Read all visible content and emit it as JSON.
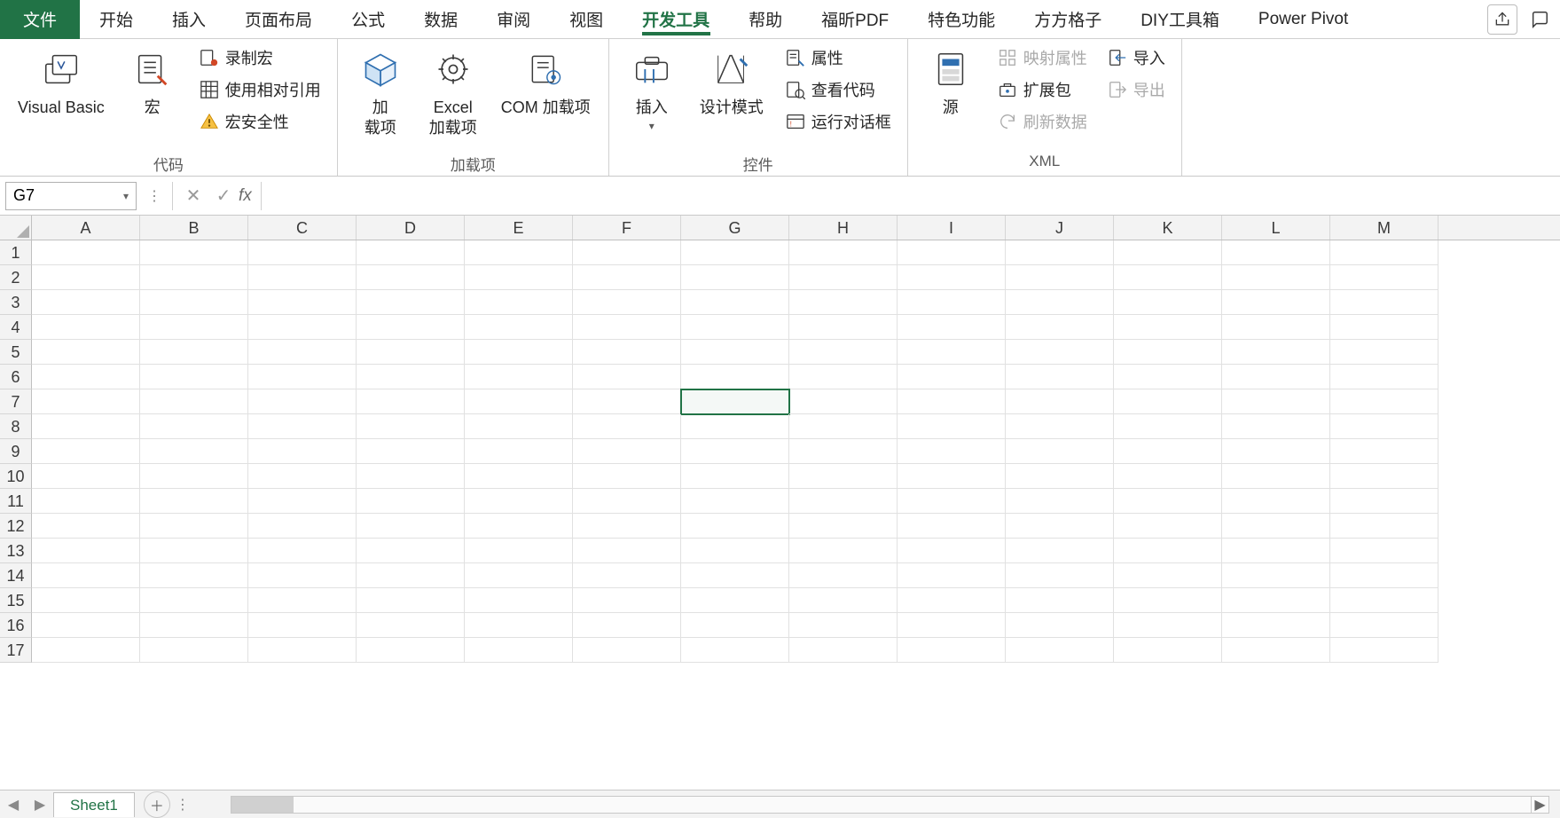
{
  "tabs": {
    "file": "文件",
    "items": [
      "开始",
      "插入",
      "页面布局",
      "公式",
      "数据",
      "审阅",
      "视图",
      "开发工具",
      "帮助",
      "福昕PDF",
      "特色功能",
      "方方格子",
      "DIY工具箱",
      "Power Pivot"
    ],
    "activeIndex": 7
  },
  "ribbon": {
    "groups": {
      "code": {
        "label": "代码",
        "visualBasic": "Visual Basic",
        "macros": "宏",
        "recordMacro": "录制宏",
        "useRelativeRefs": "使用相对引用",
        "macroSecurity": "宏安全性"
      },
      "addins": {
        "label": "加载项",
        "addins": "加\n载项",
        "excelAddins": "Excel\n加载项",
        "comAddins": "COM 加载项"
      },
      "controls": {
        "label": "控件",
        "insert": "插入",
        "designMode": "设计模式",
        "properties": "属性",
        "viewCode": "查看代码",
        "runDialog": "运行对话框"
      },
      "xml": {
        "label": "XML",
        "source": "源",
        "mapProps": "映射属性",
        "expansionPack": "扩展包",
        "refreshData": "刷新数据",
        "import": "导入",
        "export": "导出"
      }
    }
  },
  "formulaBar": {
    "nameBox": "G7",
    "formula": ""
  },
  "grid": {
    "columns": [
      "A",
      "B",
      "C",
      "D",
      "E",
      "F",
      "G",
      "H",
      "I",
      "J",
      "K",
      "L",
      "M"
    ],
    "rows": [
      "1",
      "2",
      "3",
      "4",
      "5",
      "6",
      "7",
      "8",
      "9",
      "10",
      "11",
      "12",
      "13",
      "14",
      "15",
      "16",
      "17"
    ],
    "selected": {
      "row": 7,
      "col": "G"
    }
  },
  "sheets": {
    "active": "Sheet1"
  }
}
